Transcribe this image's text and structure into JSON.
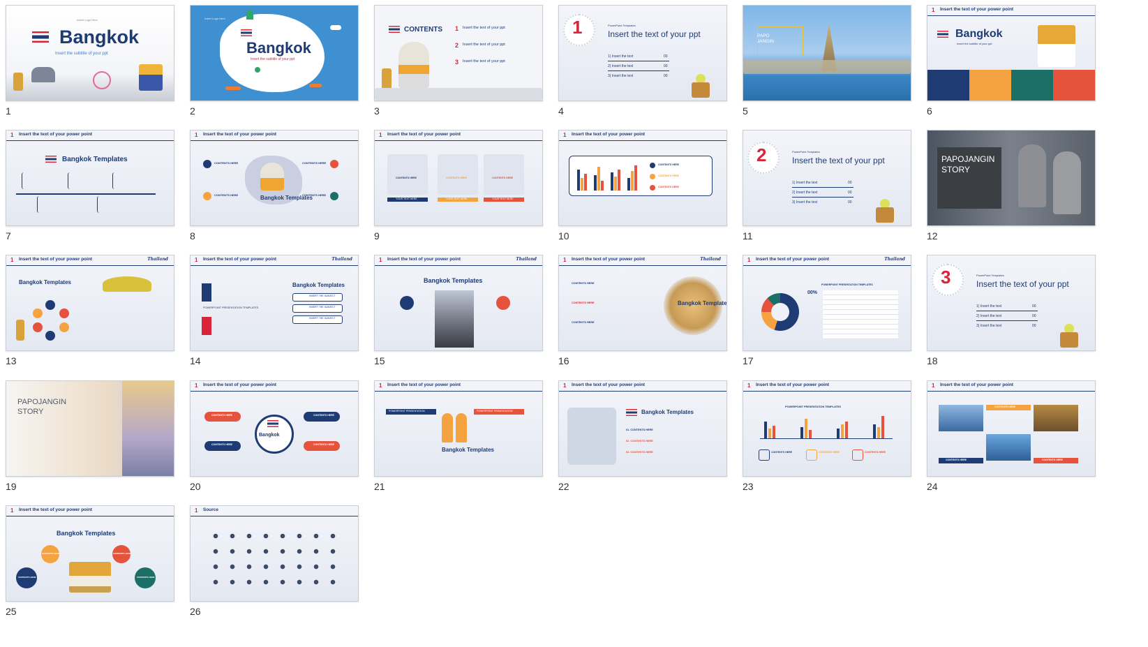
{
  "slides": [
    {
      "n": "1",
      "title": "Bangkok",
      "subtitle": "Insert the subtitle of your ppt",
      "logo": "Insert Logo Here"
    },
    {
      "n": "2",
      "title": "Bangkok",
      "subtitle": "Insert the subtitle of your ppt",
      "logo": "Insert Logo Here"
    },
    {
      "n": "3",
      "title": "CONTENTS",
      "items": [
        "Insert the text of your ppt",
        "Insert the text of your ppt",
        "Insert the text of your ppt"
      ],
      "nums": [
        "1",
        "2",
        "3"
      ]
    },
    {
      "n": "4",
      "big": "1",
      "kicker": "PowerPoint Templates",
      "title": "Insert the text of your ppt",
      "rows": [
        "1) Insert the text",
        "2) Insert the text",
        "3) Insert the text"
      ],
      "vals": [
        "00",
        "00",
        "00"
      ]
    },
    {
      "n": "5",
      "caption": "PAPO JANGIN"
    },
    {
      "n": "6",
      "header": "Insert the text of your power point",
      "title": "Bangkok",
      "subtitle": "Insert the subtitle of your ppt"
    },
    {
      "n": "7",
      "header": "Insert the text of your power point",
      "title": "Bangkok Templates"
    },
    {
      "n": "8",
      "header": "Insert the text of your power point",
      "title": "Bangkok Templates",
      "labels": [
        "CONTENTS HERE",
        "CONTENTS HERE",
        "CONTENTS HERE",
        "CONTENTS HERE"
      ]
    },
    {
      "n": "9",
      "header": "Insert the text of your power point",
      "labels": [
        "CONTENTS HERE",
        "CONTENTS HERE",
        "CONTENTS HERE"
      ],
      "btns": [
        "YOUR TEXT HERE",
        "YOUR TEXT HERE",
        "YOUR TEXT HERE"
      ]
    },
    {
      "n": "10",
      "header": "Insert the text of your power point",
      "labels": [
        "CONTENTS HERE",
        "CONTENTS HERE",
        "CONTENTS HERE"
      ]
    },
    {
      "n": "11",
      "big": "2",
      "kicker": "PowerPoint Templates",
      "title": "Insert the text of your ppt",
      "rows": [
        "1) Insert the text",
        "2) Insert the text",
        "3) Insert the text"
      ],
      "vals": [
        "00",
        "00",
        "00"
      ]
    },
    {
      "n": "12",
      "title": "PAPOJANGIN STORY"
    },
    {
      "n": "13",
      "header": "Insert the text of your power point",
      "title": "Bangkok Templates",
      "logo": "Thailand"
    },
    {
      "n": "14",
      "header": "Insert the text of your power point",
      "title": "Bangkok Templates",
      "mid": "POWERPOINT PRESENTATION TEMPLATES",
      "btns": [
        "INSERT THE SUBJECT",
        "INSERT THE SUBJECT",
        "INSERT THE SUBJECT"
      ],
      "logo": "Thailand"
    },
    {
      "n": "15",
      "header": "Insert the text of your power point",
      "title": "Bangkok Templates",
      "logo": "Thailand"
    },
    {
      "n": "16",
      "header": "Insert the text of your power point",
      "title": "Bangkok Templates",
      "labels": [
        "CONTENTS HERE",
        "CONTENTS HERE",
        "CONTENTS HERE"
      ],
      "logo": "Thailand"
    },
    {
      "n": "17",
      "header": "Insert the text of your power point",
      "pct": "00%",
      "caption": "POWERPOINT PRESENTATION TEMPLATES",
      "logo": "Thailand"
    },
    {
      "n": "18",
      "big": "3",
      "kicker": "PowerPoint Templates",
      "title": "Insert the text of your ppt",
      "rows": [
        "1) Insert the text",
        "2) Insert the text",
        "3) Insert the text"
      ],
      "vals": [
        "00",
        "00",
        "00"
      ]
    },
    {
      "n": "19",
      "title": "PAPOJANGIN STORY"
    },
    {
      "n": "20",
      "header": "Insert the text of your power point",
      "title": "Bangkok",
      "labels": [
        "CONTENTS HERE",
        "CONTENTS HERE",
        "CONTENTS HERE",
        "CONTENTS HERE"
      ]
    },
    {
      "n": "21",
      "header": "Insert the text of your power point",
      "title": "Bangkok Templates",
      "tags": [
        "POWERPOINT PRESENTATION",
        "POWERPOINT PRESENTATION"
      ]
    },
    {
      "n": "22",
      "header": "Insert the text of your power point",
      "title": "Bangkok Templates",
      "labels": [
        "01. CONTENTS HERE",
        "02. CONTENTS HERE",
        "03. CONTENTS HERE"
      ]
    },
    {
      "n": "23",
      "header": "Insert the text of your power point",
      "caption": "POWERPOINT PRESENTATION TEMPLATES",
      "labels": [
        "CONTENTS HERE",
        "CONTENTS HERE",
        "CONTENTS HERE"
      ]
    },
    {
      "n": "24",
      "header": "Insert the text of your power point",
      "labels": [
        "CONTENTS HERE",
        "CONTENTS HERE",
        "CONTENTS HERE"
      ]
    },
    {
      "n": "25",
      "header": "Insert the text of your power point",
      "title": "Bangkok Templates",
      "labels": [
        "CONTENTS HERE",
        "CONTENTS HERE",
        "CONTENTS HERE"
      ]
    },
    {
      "n": "26",
      "header": "Source"
    }
  ],
  "colors": {
    "navy": "#1f3b73",
    "red": "#d9243a",
    "orange": "#f5a341",
    "teal": "#1b6f66",
    "sky": "#3f9ad6",
    "coral": "#e5533c"
  }
}
